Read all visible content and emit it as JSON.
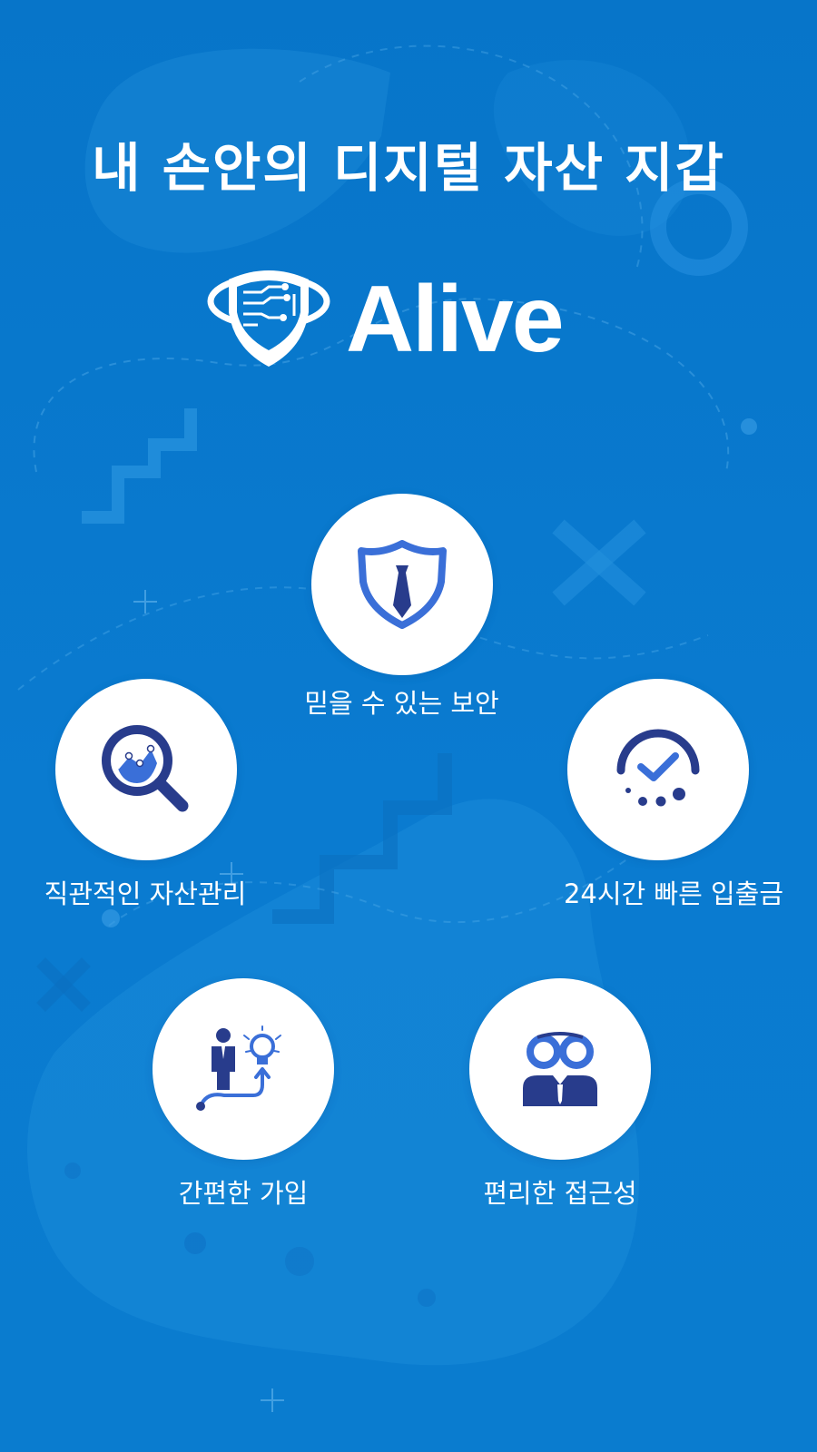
{
  "header": {
    "headline": "내 손안의 디지털 자산 지갑"
  },
  "brand": {
    "name": "Alive",
    "logo_icon": "shield-circuit-logo"
  },
  "colors": {
    "background": "#0a7bd0",
    "icon_navy": "#283c8c",
    "icon_blue": "#3a6fd8",
    "white": "#ffffff"
  },
  "features": [
    {
      "label": "믿을 수 있는 보안",
      "icon": "shield-tie-icon"
    },
    {
      "label": "직관적인 자산관리",
      "icon": "magnifier-chart-icon"
    },
    {
      "label": "24시간 빠른 입출금",
      "icon": "speed-check-icon"
    },
    {
      "label": "간편한 가입",
      "icon": "person-idea-icon"
    },
    {
      "label": "편리한 접근성",
      "icon": "binoculars-person-icon"
    }
  ]
}
